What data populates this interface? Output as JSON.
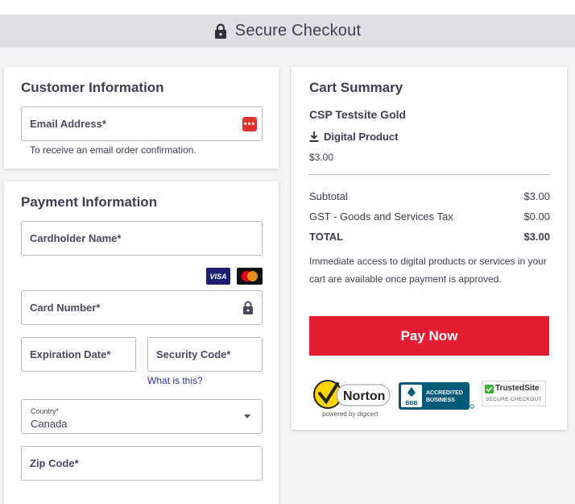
{
  "header": {
    "title": "Secure Checkout",
    "icon": "lock-icon"
  },
  "customer": {
    "heading": "Customer Information",
    "email_label": "Email Address*",
    "email_help": "To receive an email order confirmation."
  },
  "payment": {
    "heading": "Payment Information",
    "cardholder_label": "Cardholder Name*",
    "card_brands": [
      "VISA",
      "Mastercard"
    ],
    "card_number_label": "Card Number*",
    "expiration_label": "Expiration Date*",
    "security_label": "Security Code*",
    "what_is_this": "What is this?",
    "country_label": "Country*",
    "country_value": "Canada",
    "zip_label": "Zip Code*"
  },
  "cart": {
    "heading": "Cart Summary",
    "product_name": "CSP Testsite Gold",
    "product_type": "Digital Product",
    "product_price": "$3.00",
    "lines": [
      {
        "label": "Subtotal",
        "value": "$3.00"
      },
      {
        "label": "GST - Goods and Services Tax",
        "value": "$0.00"
      },
      {
        "label": "TOTAL",
        "value": "$3.00"
      }
    ],
    "note": "Immediate access to digital products or services in your cart are available once payment is approved.",
    "pay_button": "Pay Now"
  },
  "badges": {
    "norton": {
      "name": "Norton",
      "sub": "powered by digicert"
    },
    "bbb": {
      "line1": "ACCREDITED",
      "line2": "BUSINESS",
      "mark": "BBB"
    },
    "trusted": {
      "name": "TrustedSite",
      "sub": "SECURE CHECKOUT"
    }
  },
  "colors": {
    "accent": "#e31e31",
    "header_bg": "#dfdfe4",
    "link": "#2f2fa0"
  }
}
